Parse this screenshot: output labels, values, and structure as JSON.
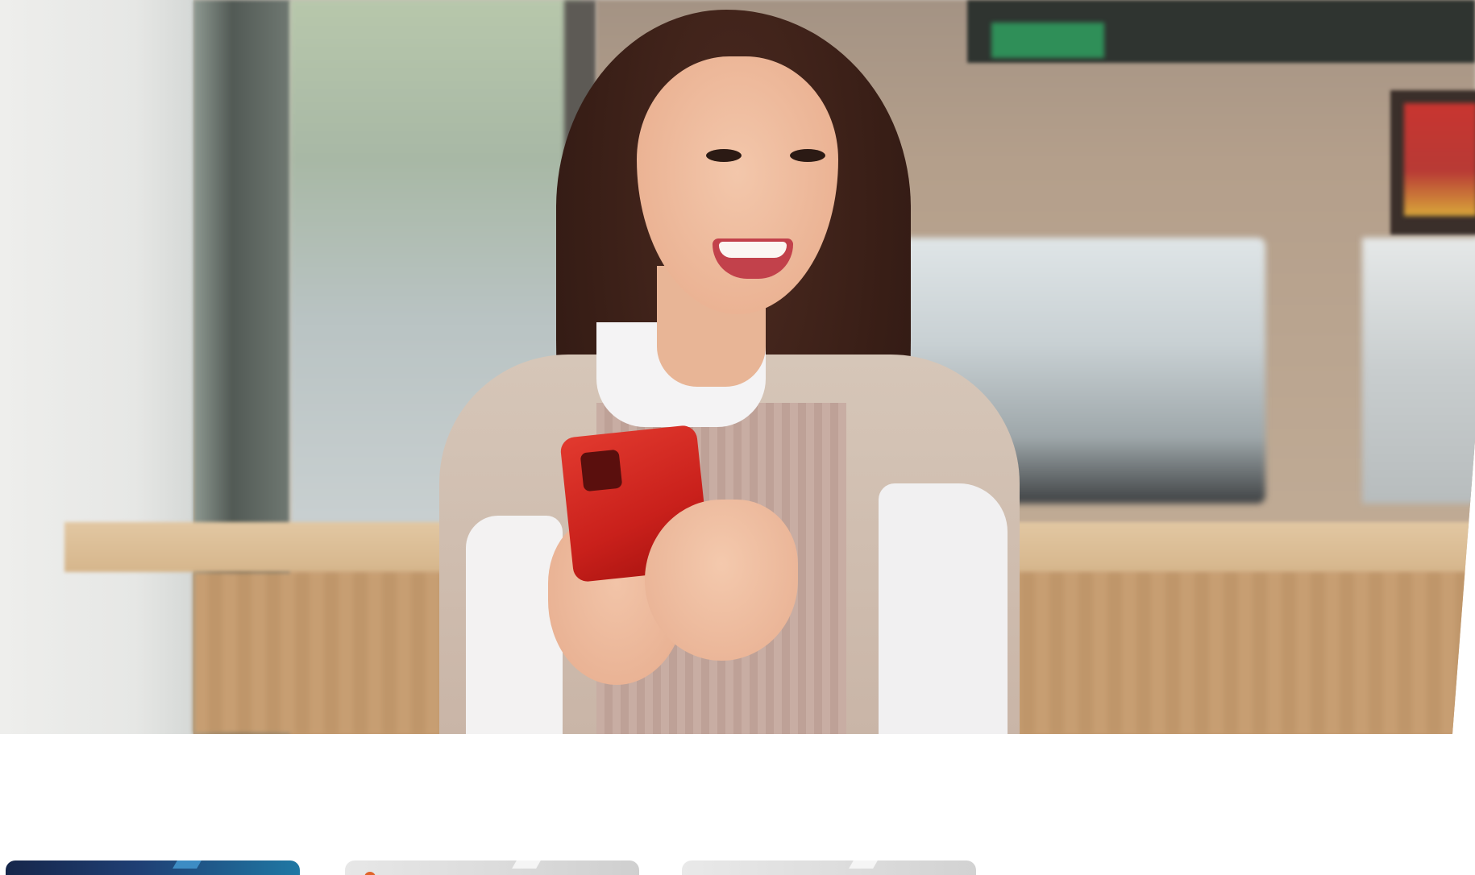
{
  "hero": {
    "image_alt": "",
    "icon": "hero-photo"
  },
  "cards": [
    {
      "icon": "credit-card-blue",
      "accent_color": "#1f3f74"
    },
    {
      "icon": "credit-card-silver",
      "accent_color": "#dcdcdc"
    },
    {
      "icon": "credit-card-silver",
      "accent_color": "#dedede"
    }
  ],
  "colors": {
    "background": "#ffffff",
    "phone": "#c9201b"
  }
}
